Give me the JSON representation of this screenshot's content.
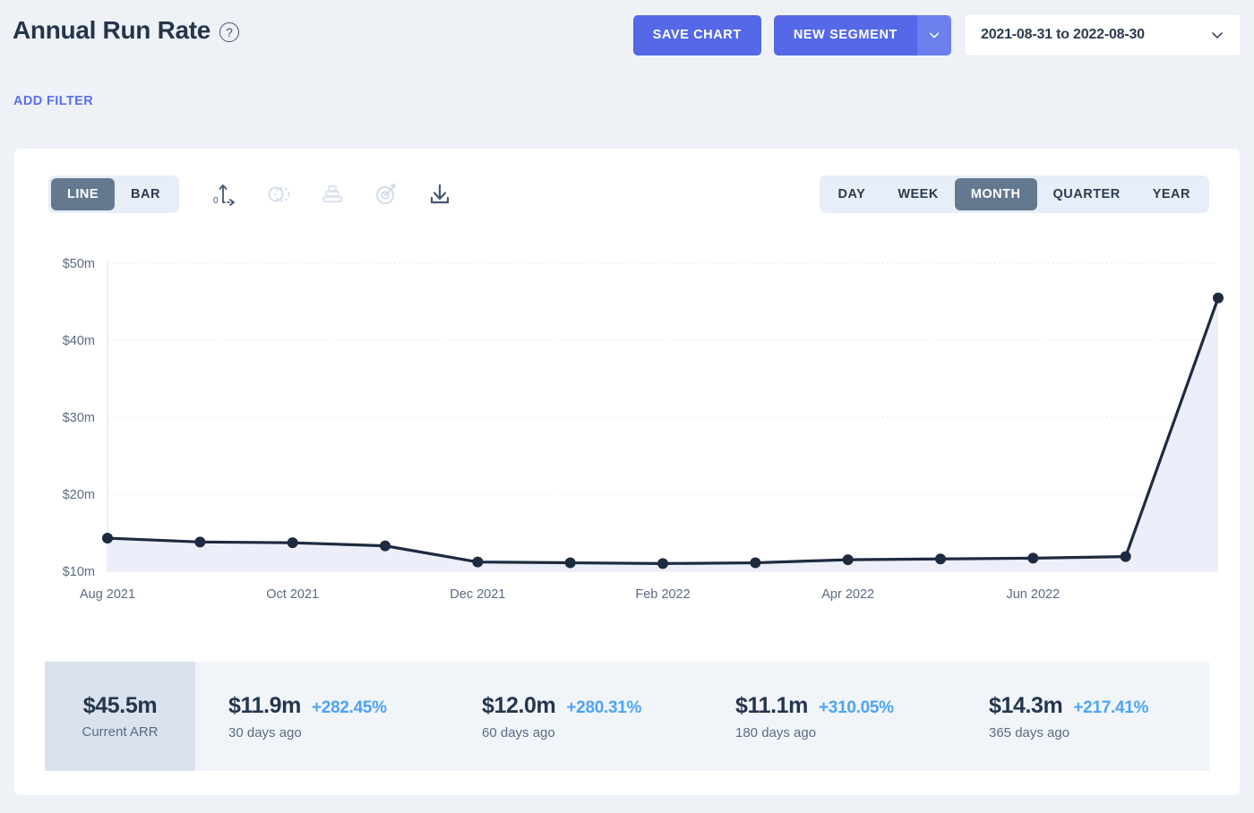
{
  "header": {
    "title": "Annual Run Rate",
    "help_icon": "question-circle-icon",
    "add_filter": "ADD FILTER",
    "save_chart": "SAVE CHART",
    "new_segment": "NEW SEGMENT",
    "new_segment_caret": "chevron-down-icon",
    "date_range": "2021-08-31 to 2022-08-30",
    "date_caret": "chevron-down-icon"
  },
  "toolbar": {
    "chart_types": [
      {
        "label": "LINE",
        "active": true
      },
      {
        "label": "BAR",
        "active": false
      }
    ],
    "icons": [
      {
        "name": "axis-scale-icon",
        "enabled": true
      },
      {
        "name": "compare-circles-icon",
        "enabled": false
      },
      {
        "name": "funnel-icon",
        "enabled": false
      },
      {
        "name": "goal-target-icon",
        "enabled": false
      },
      {
        "name": "download-icon",
        "enabled": true
      }
    ],
    "granularity": [
      {
        "label": "DAY",
        "active": false
      },
      {
        "label": "WEEK",
        "active": false
      },
      {
        "label": "MONTH",
        "active": true
      },
      {
        "label": "QUARTER",
        "active": false
      },
      {
        "label": "YEAR",
        "active": false
      }
    ]
  },
  "chart_data": {
    "type": "line",
    "title": "Annual Run Rate",
    "xlabel": "",
    "ylabel": "",
    "ylim": [
      10,
      50
    ],
    "ytick_labels": [
      "$10m",
      "$20m",
      "$30m",
      "$40m",
      "$50m"
    ],
    "ytick_values": [
      10,
      20,
      30,
      40,
      50
    ],
    "xtick_labels": [
      "Aug 2021",
      "Oct 2021",
      "Dec 2021",
      "Feb 2022",
      "Apr 2022",
      "Jun 2022"
    ],
    "xtick_indices": [
      0,
      2,
      4,
      6,
      8,
      10
    ],
    "grid": true,
    "legend": "none",
    "area_fill": true,
    "line_color": "#1e2a40",
    "fill_color": "#eceef9",
    "x": [
      "Aug 2021",
      "Sep 2021",
      "Oct 2021",
      "Nov 2021",
      "Dec 2021",
      "Jan 2022",
      "Feb 2022",
      "Mar 2022",
      "Apr 2022",
      "May 2022",
      "Jun 2022",
      "Jul 2022",
      "Aug 2022"
    ],
    "values": [
      14.3,
      13.8,
      13.7,
      13.3,
      11.2,
      11.1,
      11.0,
      11.1,
      11.5,
      11.6,
      11.7,
      11.9,
      45.5
    ]
  },
  "stats": {
    "current": {
      "value": "$45.5m",
      "label": "Current ARR"
    },
    "items": [
      {
        "value": "$11.9m",
        "delta": "+282.45%",
        "label": "30 days ago"
      },
      {
        "value": "$12.0m",
        "delta": "+280.31%",
        "label": "60 days ago"
      },
      {
        "value": "$11.1m",
        "delta": "+310.05%",
        "label": "180 days ago"
      },
      {
        "value": "$14.3m",
        "delta": "+217.41%",
        "label": "365 days ago"
      }
    ]
  },
  "colors": {
    "accent": "#5468e8",
    "link": "#5b6ff0",
    "delta": "#4da3f5",
    "line": "#1e2a40",
    "page_bg": "#eef2f7"
  }
}
